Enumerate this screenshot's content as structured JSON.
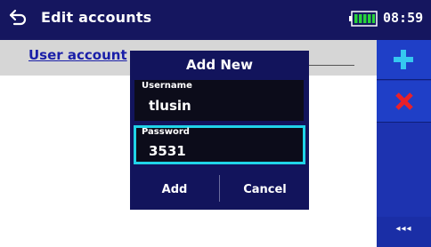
{
  "header": {
    "title": "Edit accounts",
    "time": "08:59",
    "battery_icon": "battery-icon",
    "back_icon": "back-icon",
    "background": "#15165f"
  },
  "section": {
    "label": "User account"
  },
  "toolbar": {
    "add_icon": "plus-icon",
    "delete_icon": "x-icon",
    "more_label": "◂◂◂",
    "background": "#1d33b0",
    "add_color": "#35c8f0",
    "delete_color": "#e8202a"
  },
  "dialog": {
    "title": "Add New",
    "username_label": "Username",
    "username_value": "tlusin",
    "password_label": "Password",
    "password_value": "3531",
    "add_label": "Add",
    "cancel_label": "Cancel",
    "highlight_color": "#20d4e8"
  }
}
